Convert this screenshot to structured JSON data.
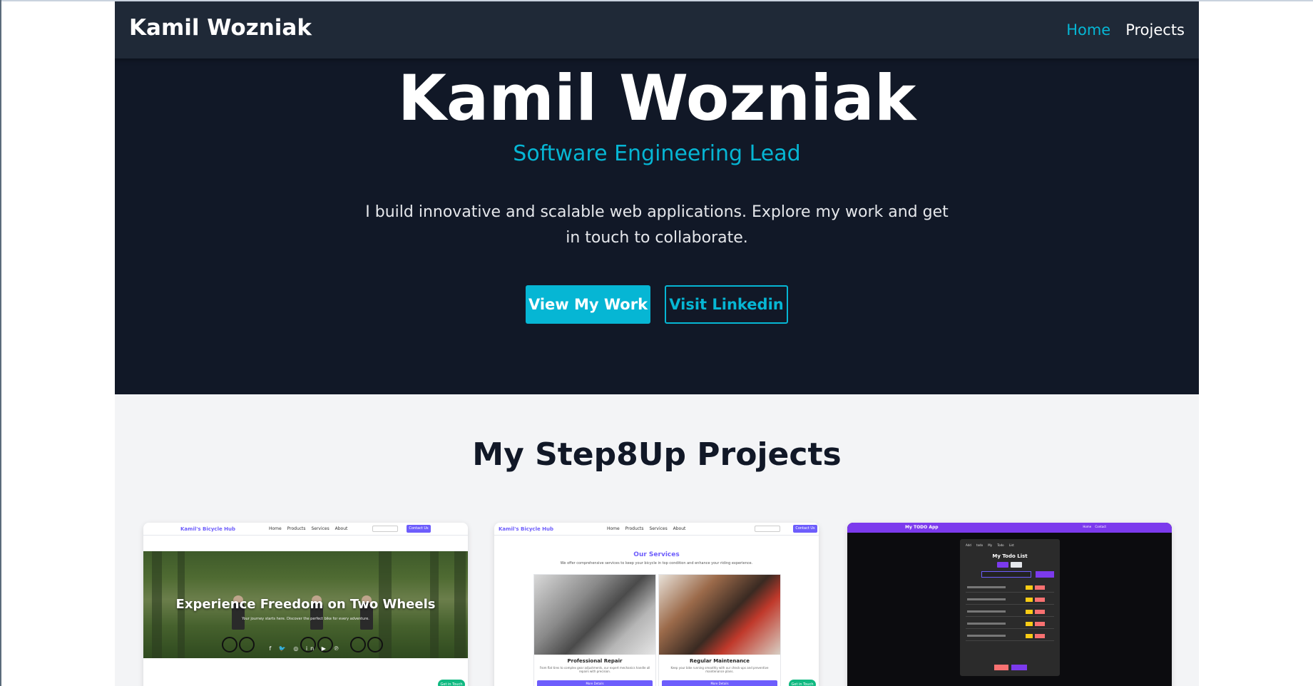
{
  "navbar": {
    "brand": "Kamil Wozniak",
    "links": [
      {
        "label": "Home",
        "active": true
      },
      {
        "label": "Projects",
        "active": false
      }
    ]
  },
  "hero": {
    "name": "Kamil Wozniak",
    "role": "Software Engineering Lead",
    "intro": "I build innovative and scalable web applications. Explore my work and get in touch to collaborate.",
    "primary_button": "View My Work",
    "secondary_button": "Visit Linkedin"
  },
  "projects": {
    "title": "My Step8Up Projects",
    "cards": [
      {
        "brand": "Kamil's Bicycle Hub",
        "nav": "Home Products Services About",
        "cta": "Contact Us",
        "headline": "Experience Freedom on Two Wheels",
        "subtext": "Your journey starts here. Discover the perfect bike for every adventure.",
        "social": "f 🐦 ◎ in ▶ ℗",
        "badge": "Get in Touch"
      },
      {
        "brand": "Kamil's Bicycle Hub",
        "nav": "Home Products Services About",
        "cta": "Contact Us",
        "services_title": "Our Services",
        "services_sub": "We offer comprehensive services to keep your bicycle in top condition and enhance your riding experience.",
        "services": [
          {
            "label": "Professional Repair",
            "desc": "From flat tires to complex gear adjustments, our expert mechanics handle all repairs with precision.",
            "button": "More Details"
          },
          {
            "label": "Regular Maintenance",
            "desc": "Keep your bike running smoothly with our check-ups and preventive maintenance plans.",
            "button": "More Details"
          }
        ],
        "badge": "Get in Touch"
      },
      {
        "brand": "My TODO App",
        "nav": "Home Contact",
        "tabs": "Add todo My Todo List",
        "title": "My Todo List",
        "accent": "#7c3aed"
      }
    ]
  },
  "colors": {
    "accent": "#06b6d4",
    "nav_bg": "#1f2937",
    "hero_bg": "#111827",
    "section_bg": "#f3f4f6"
  }
}
